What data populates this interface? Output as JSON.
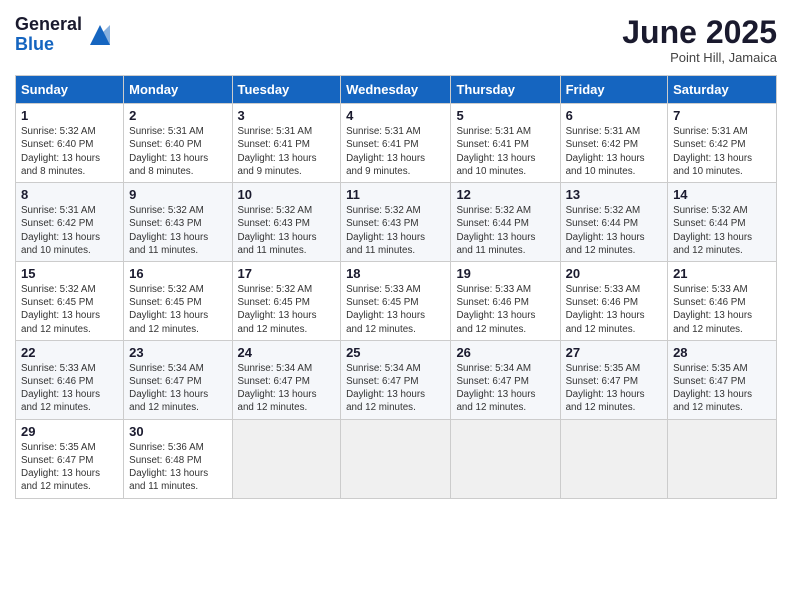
{
  "logo": {
    "general": "General",
    "blue": "Blue"
  },
  "title": "June 2025",
  "location": "Point Hill, Jamaica",
  "days_header": [
    "Sunday",
    "Monday",
    "Tuesday",
    "Wednesday",
    "Thursday",
    "Friday",
    "Saturday"
  ],
  "weeks": [
    [
      {
        "day": "1",
        "sunrise": "5:32 AM",
        "sunset": "6:40 PM",
        "daylight": "13 hours and 8 minutes."
      },
      {
        "day": "2",
        "sunrise": "5:31 AM",
        "sunset": "6:40 PM",
        "daylight": "13 hours and 8 minutes."
      },
      {
        "day": "3",
        "sunrise": "5:31 AM",
        "sunset": "6:41 PM",
        "daylight": "13 hours and 9 minutes."
      },
      {
        "day": "4",
        "sunrise": "5:31 AM",
        "sunset": "6:41 PM",
        "daylight": "13 hours and 9 minutes."
      },
      {
        "day": "5",
        "sunrise": "5:31 AM",
        "sunset": "6:41 PM",
        "daylight": "13 hours and 10 minutes."
      },
      {
        "day": "6",
        "sunrise": "5:31 AM",
        "sunset": "6:42 PM",
        "daylight": "13 hours and 10 minutes."
      },
      {
        "day": "7",
        "sunrise": "5:31 AM",
        "sunset": "6:42 PM",
        "daylight": "13 hours and 10 minutes."
      }
    ],
    [
      {
        "day": "8",
        "sunrise": "5:31 AM",
        "sunset": "6:42 PM",
        "daylight": "13 hours and 10 minutes."
      },
      {
        "day": "9",
        "sunrise": "5:32 AM",
        "sunset": "6:43 PM",
        "daylight": "13 hours and 11 minutes."
      },
      {
        "day": "10",
        "sunrise": "5:32 AM",
        "sunset": "6:43 PM",
        "daylight": "13 hours and 11 minutes."
      },
      {
        "day": "11",
        "sunrise": "5:32 AM",
        "sunset": "6:43 PM",
        "daylight": "13 hours and 11 minutes."
      },
      {
        "day": "12",
        "sunrise": "5:32 AM",
        "sunset": "6:44 PM",
        "daylight": "13 hours and 11 minutes."
      },
      {
        "day": "13",
        "sunrise": "5:32 AM",
        "sunset": "6:44 PM",
        "daylight": "13 hours and 12 minutes."
      },
      {
        "day": "14",
        "sunrise": "5:32 AM",
        "sunset": "6:44 PM",
        "daylight": "13 hours and 12 minutes."
      }
    ],
    [
      {
        "day": "15",
        "sunrise": "5:32 AM",
        "sunset": "6:45 PM",
        "daylight": "13 hours and 12 minutes."
      },
      {
        "day": "16",
        "sunrise": "5:32 AM",
        "sunset": "6:45 PM",
        "daylight": "13 hours and 12 minutes."
      },
      {
        "day": "17",
        "sunrise": "5:32 AM",
        "sunset": "6:45 PM",
        "daylight": "13 hours and 12 minutes."
      },
      {
        "day": "18",
        "sunrise": "5:33 AM",
        "sunset": "6:45 PM",
        "daylight": "13 hours and 12 minutes."
      },
      {
        "day": "19",
        "sunrise": "5:33 AM",
        "sunset": "6:46 PM",
        "daylight": "13 hours and 12 minutes."
      },
      {
        "day": "20",
        "sunrise": "5:33 AM",
        "sunset": "6:46 PM",
        "daylight": "13 hours and 12 minutes."
      },
      {
        "day": "21",
        "sunrise": "5:33 AM",
        "sunset": "6:46 PM",
        "daylight": "13 hours and 12 minutes."
      }
    ],
    [
      {
        "day": "22",
        "sunrise": "5:33 AM",
        "sunset": "6:46 PM",
        "daylight": "13 hours and 12 minutes."
      },
      {
        "day": "23",
        "sunrise": "5:34 AM",
        "sunset": "6:47 PM",
        "daylight": "13 hours and 12 minutes."
      },
      {
        "day": "24",
        "sunrise": "5:34 AM",
        "sunset": "6:47 PM",
        "daylight": "13 hours and 12 minutes."
      },
      {
        "day": "25",
        "sunrise": "5:34 AM",
        "sunset": "6:47 PM",
        "daylight": "13 hours and 12 minutes."
      },
      {
        "day": "26",
        "sunrise": "5:34 AM",
        "sunset": "6:47 PM",
        "daylight": "13 hours and 12 minutes."
      },
      {
        "day": "27",
        "sunrise": "5:35 AM",
        "sunset": "6:47 PM",
        "daylight": "13 hours and 12 minutes."
      },
      {
        "day": "28",
        "sunrise": "5:35 AM",
        "sunset": "6:47 PM",
        "daylight": "13 hours and 12 minutes."
      }
    ],
    [
      {
        "day": "29",
        "sunrise": "5:35 AM",
        "sunset": "6:47 PM",
        "daylight": "13 hours and 12 minutes."
      },
      {
        "day": "30",
        "sunrise": "5:36 AM",
        "sunset": "6:48 PM",
        "daylight": "13 hours and 11 minutes."
      },
      null,
      null,
      null,
      null,
      null
    ]
  ],
  "labels": {
    "sunrise": "Sunrise: ",
    "sunset": "Sunset: ",
    "daylight": "Daylight: "
  }
}
